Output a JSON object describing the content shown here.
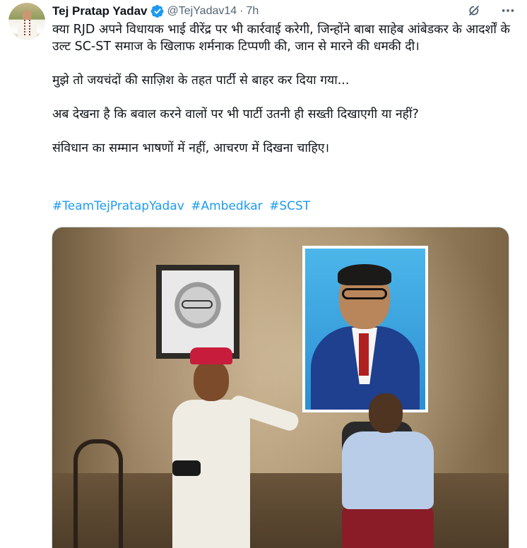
{
  "tweet": {
    "author": {
      "name": "Tej Pratap Yadav",
      "handle": "@TejYadav14",
      "time": "7h",
      "separator": "·"
    },
    "text": {
      "p1": "क्या RJD अपने विधायक भाई वीरेंद्र पर भी कार्रवाई करेगी, जिन्होंने बाबा साहेब आंबेडकर के आदर्शों के उल्ट SC-ST समाज के खिलाफ शर्मनाक टिप्पणी की, जान से मारने की धमकी दी।",
      "p2": "मुझे तो जयचंदों की साज़िश के तहत पार्टी से बाहर कर दिया गया...",
      "p3": "अब देखना है कि बवाल करने वालों पर भी पार्टी उतनी ही सख्ती दिखाएगी या नहीं?",
      "p4": "संविधान का सम्मान भाषणों में नहीं, आचरण में दिखना चाहिए।"
    },
    "hashtags": [
      "#TeamTejPratapYadav",
      "#Ambedkar",
      "#SCST"
    ],
    "icons": {
      "verified": "verified-badge-icon",
      "grok": "grok-icon",
      "more": "more-icon"
    },
    "colors": {
      "link": "#1d9bf0",
      "verified": "#1d9bf0",
      "secondary_text": "#536471"
    }
  }
}
